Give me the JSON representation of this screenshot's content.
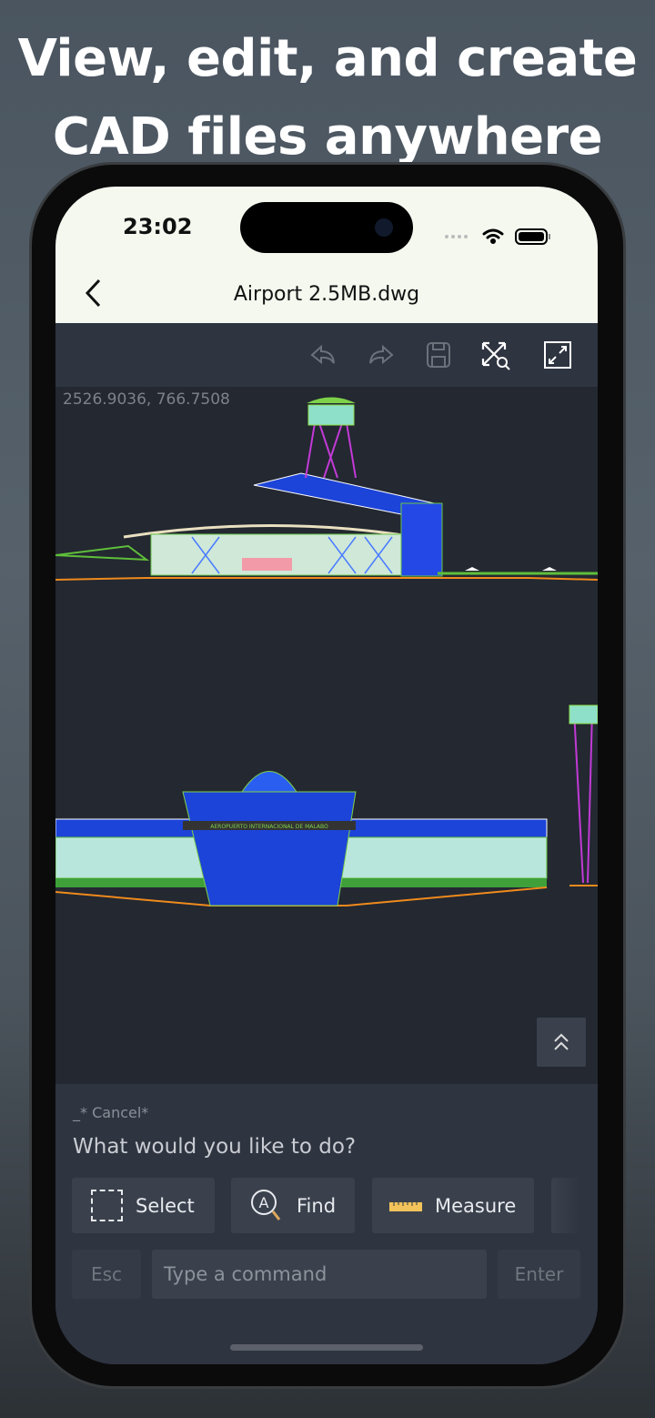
{
  "headline": {
    "line1": "View, edit, and create",
    "line2": "CAD files anywhere"
  },
  "status_bar": {
    "time": "23:02"
  },
  "nav": {
    "title": "Airport 2.5MB.dwg",
    "back_icon": "chevron-left-icon"
  },
  "toolbar": {
    "icons": [
      "undo-icon",
      "redo-icon",
      "save-icon",
      "zoom-extents-icon",
      "fullscreen-icon"
    ]
  },
  "canvas": {
    "coordinates": "2526.9036, 766.7508",
    "drawing_sign": "AEROPUERTO INTERNACIONAL DE MALABO",
    "scroll_up_icon": "chevrons-up-icon"
  },
  "command_panel": {
    "last_command": "_* Cancel*",
    "prompt": "What would you like to do?",
    "actions": [
      {
        "label": "Select",
        "icon": "dashed-select-icon"
      },
      {
        "label": "Find",
        "icon": "find-icon"
      },
      {
        "label": "Measure",
        "icon": "ruler-icon"
      }
    ],
    "esc_label": "Esc",
    "input_placeholder": "Type a command",
    "enter_label": "Enter"
  },
  "colors": {
    "accent_yellow": "#f2c35a",
    "panel": "#2e3440",
    "canvas": "#232831"
  }
}
